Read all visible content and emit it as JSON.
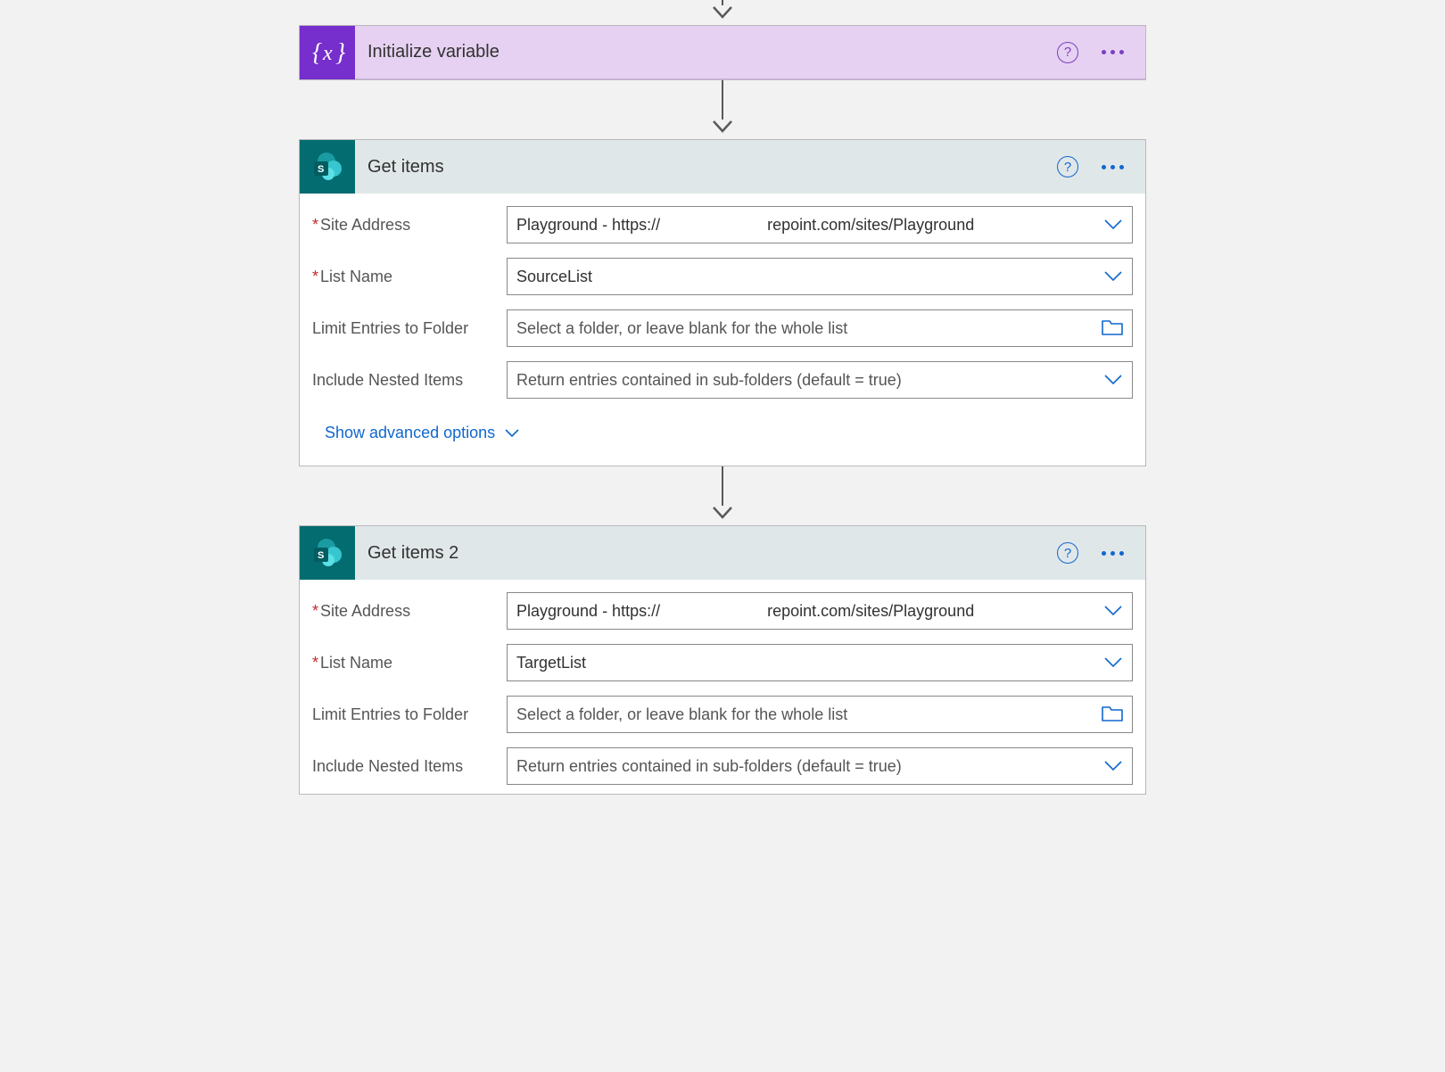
{
  "steps": [
    {
      "id": "initialize-variable",
      "style": "purple",
      "icon": "variable",
      "title": "Initialize variable",
      "collapsed": true
    },
    {
      "id": "get-items",
      "style": "teal",
      "icon": "sharepoint",
      "title": "Get items",
      "collapsed": false,
      "fields": {
        "siteAddress": {
          "label": "Site Address",
          "required": true,
          "value_prefix": "Playground - https://",
          "value_suffix": "repoint.com/sites/Playground",
          "control": "dropdown"
        },
        "listName": {
          "label": "List Name",
          "required": true,
          "value": "SourceList",
          "control": "dropdown"
        },
        "limitFolder": {
          "label": "Limit Entries to Folder",
          "required": false,
          "placeholder": "Select a folder, or leave blank for the whole list",
          "control": "folder"
        },
        "includeNested": {
          "label": "Include Nested Items",
          "required": false,
          "placeholder": "Return entries contained in sub-folders (default = true)",
          "control": "dropdown"
        }
      },
      "advancedLink": "Show advanced options"
    },
    {
      "id": "get-items-2",
      "style": "teal",
      "icon": "sharepoint",
      "title": "Get items 2",
      "collapsed": false,
      "fields": {
        "siteAddress": {
          "label": "Site Address",
          "required": true,
          "value_prefix": "Playground - https://",
          "value_suffix": "repoint.com/sites/Playground",
          "control": "dropdown"
        },
        "listName": {
          "label": "List Name",
          "required": true,
          "value": "TargetList",
          "control": "dropdown"
        },
        "limitFolder": {
          "label": "Limit Entries to Folder",
          "required": false,
          "placeholder": "Select a folder, or leave blank for the whole list",
          "control": "folder"
        },
        "includeNested": {
          "label": "Include Nested Items",
          "required": false,
          "placeholder": "Return entries contained in sub-folders (default = true)",
          "control": "dropdown"
        }
      }
    }
  ]
}
